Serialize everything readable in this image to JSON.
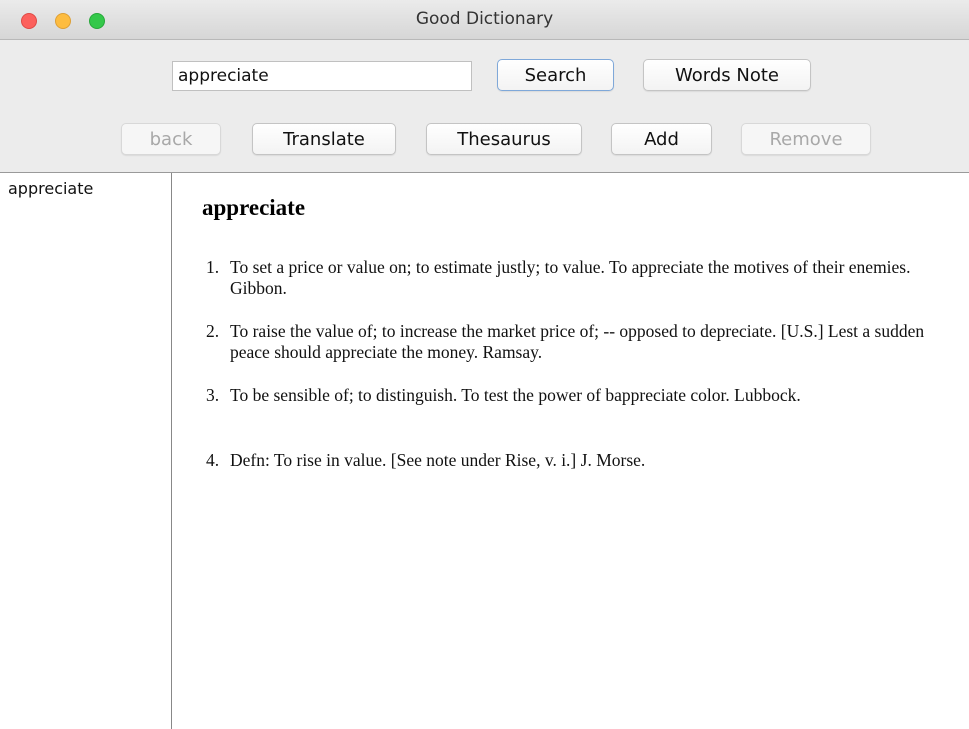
{
  "window": {
    "title": "Good Dictionary"
  },
  "toolbar": {
    "search_value": "appreciate",
    "search_label": "Search",
    "words_note_label": "Words Note",
    "back_label": "back",
    "translate_label": "Translate",
    "thesaurus_label": "Thesaurus",
    "add_label": "Add",
    "remove_label": "Remove"
  },
  "wordlist": {
    "items": [
      "appreciate"
    ]
  },
  "definition": {
    "headword": "appreciate",
    "senses": [
      {
        "num": "1.",
        "text": "To set a price or value on; to estimate justly; to value. To appreciate the motives of their enemies. Gibbon."
      },
      {
        "num": "2.",
        "text": "To raise the value of; to increase the market price of; -- opposed to depreciate. [U.S.] Lest a sudden peace should appreciate the money. Ramsay."
      },
      {
        "num": "3.",
        "text": "To be sensible of; to distinguish. To test the power of bappreciate color. Lubbock."
      },
      {
        "num": "4.",
        "text": "Defn: To rise in value. [See note under Rise, v. i.] J. Morse."
      }
    ]
  }
}
